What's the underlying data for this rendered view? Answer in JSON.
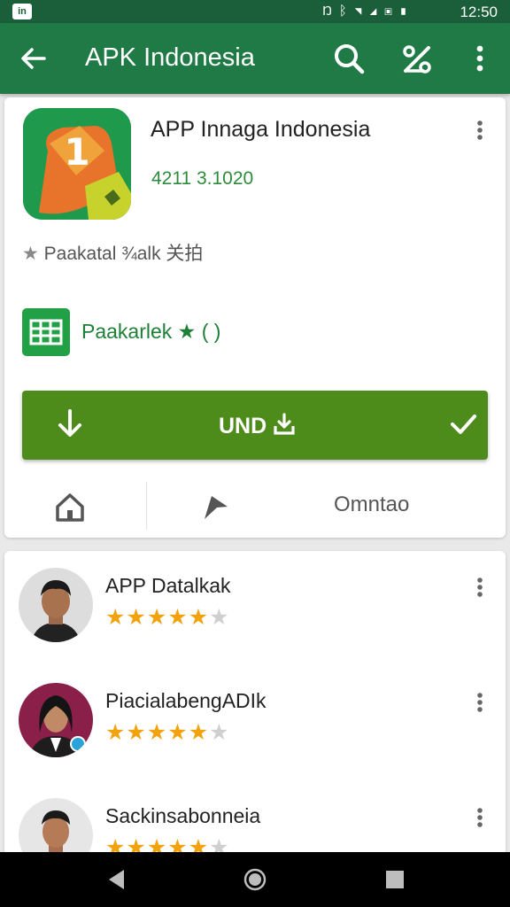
{
  "status_bar": {
    "app_icon_text": "in",
    "icons": [
      "nfc-icon",
      "bluetooth-icon",
      "wifi-icon",
      "signal-icon",
      "data-icon",
      "battery-icon"
    ],
    "time": "12:50"
  },
  "app_bar": {
    "title": "APK Indonesia",
    "icons": [
      "back-arrow-icon",
      "search-icon",
      "share-icon",
      "more-vert-icon"
    ]
  },
  "app_card": {
    "name": "APP Innaga Indonesia",
    "meta": "4211 3.1020",
    "rating_line": "Paakatal  ¾alk 关拍",
    "promo_text": "Paakarlek",
    "promo_suffix": "( )",
    "install_label": "UND",
    "actions": {
      "more_label": "Omntao"
    },
    "colors": {
      "accent": "#207a45",
      "install": "#4d8b1b",
      "promo": "#1e7f37"
    }
  },
  "reviews": [
    {
      "name": "APP Datalkak",
      "rating": 5,
      "max": 6
    },
    {
      "name": "PiacialabengADIk",
      "rating": 5,
      "max": 6
    },
    {
      "name": "Sackinsabonneia",
      "rating": 5,
      "max": 6
    }
  ],
  "nav_bar": {
    "icons": [
      "nav-back-icon",
      "nav-home-icon",
      "nav-recents-icon"
    ]
  }
}
